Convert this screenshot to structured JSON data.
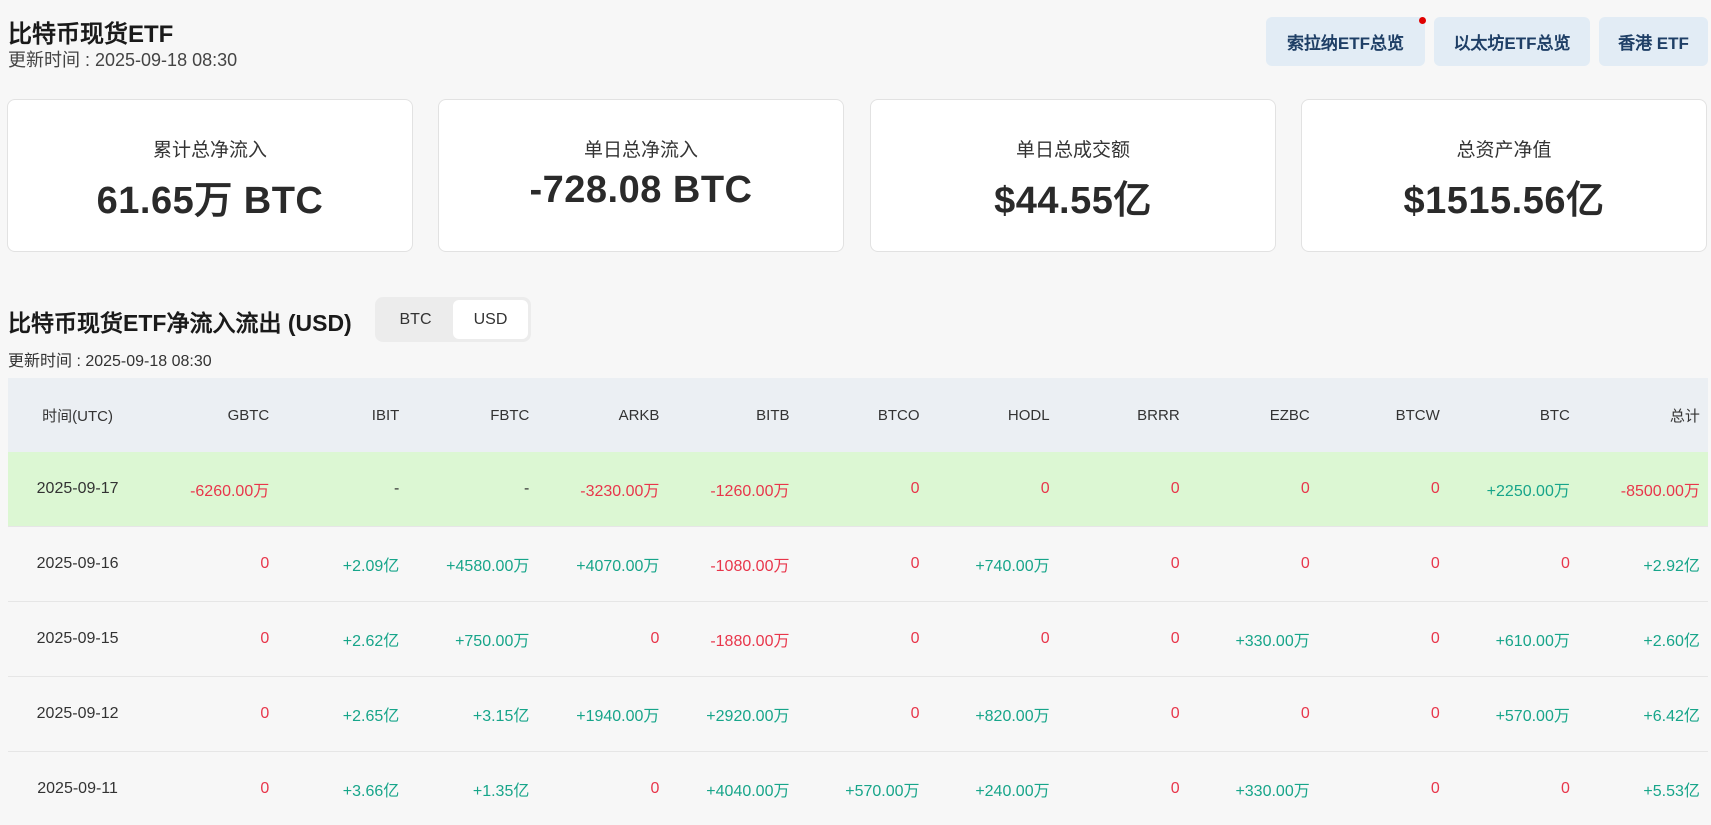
{
  "header": {
    "title": "比特币现货ETF",
    "update_time": "更新时间 : 2025-09-18 08:30",
    "nav": [
      {
        "label": "索拉纳ETF总览"
      },
      {
        "label": "以太坊ETF总览"
      },
      {
        "label": "香港 ETF"
      }
    ]
  },
  "stats": [
    {
      "label": "累计总净流入",
      "value": "61.65万 BTC"
    },
    {
      "label": "单日总净流入",
      "value": "-728.08 BTC"
    },
    {
      "label": "单日总成交额",
      "value": "$44.55亿"
    },
    {
      "label": "总资产净值",
      "value": "$1515.56亿"
    }
  ],
  "section": {
    "title": "比特币现货ETF净流入流出 (USD)",
    "toggle": [
      {
        "label": "BTC"
      },
      {
        "label": "USD"
      }
    ],
    "toggle_selected": "USD",
    "update_time": "更新时间 : 2025-09-18 08:30"
  },
  "table": {
    "columns": [
      "时间(UTC)",
      "GBTC",
      "IBIT",
      "FBTC",
      "ARKB",
      "BITB",
      "BTCO",
      "HODL",
      "BRRR",
      "EZBC",
      "BTCW",
      "BTC",
      "总计"
    ],
    "rows": [
      {
        "date": "2025-09-17",
        "values": [
          "-6260.00万",
          "-",
          "-",
          "-3230.00万",
          "-1260.00万",
          "0",
          "0",
          "0",
          "0",
          "0",
          "+2250.00万",
          "-8500.00万"
        ]
      },
      {
        "date": "2025-09-16",
        "values": [
          "0",
          "+2.09亿",
          "+4580.00万",
          "+4070.00万",
          "-1080.00万",
          "0",
          "+740.00万",
          "0",
          "0",
          "0",
          "0",
          "+2.92亿"
        ]
      },
      {
        "date": "2025-09-15",
        "values": [
          "0",
          "+2.62亿",
          "+750.00万",
          "0",
          "-1880.00万",
          "0",
          "0",
          "0",
          "+330.00万",
          "0",
          "+610.00万",
          "+2.60亿"
        ]
      },
      {
        "date": "2025-09-12",
        "values": [
          "0",
          "+2.65亿",
          "+3.15亿",
          "+1940.00万",
          "+2920.00万",
          "0",
          "+820.00万",
          "0",
          "0",
          "0",
          "+570.00万",
          "+6.42亿"
        ]
      },
      {
        "date": "2025-09-11",
        "values": [
          "0",
          "+3.66亿",
          "+1.35亿",
          "0",
          "+4040.00万",
          "+570.00万",
          "+240.00万",
          "0",
          "+330.00万",
          "0",
          "0",
          "+5.53亿"
        ]
      }
    ]
  },
  "colors": {
    "positive": "#17a58a",
    "negative": "#e8364b",
    "highlight_row": "#dcf7d3",
    "nav_button_bg": "#e2ecf5"
  }
}
